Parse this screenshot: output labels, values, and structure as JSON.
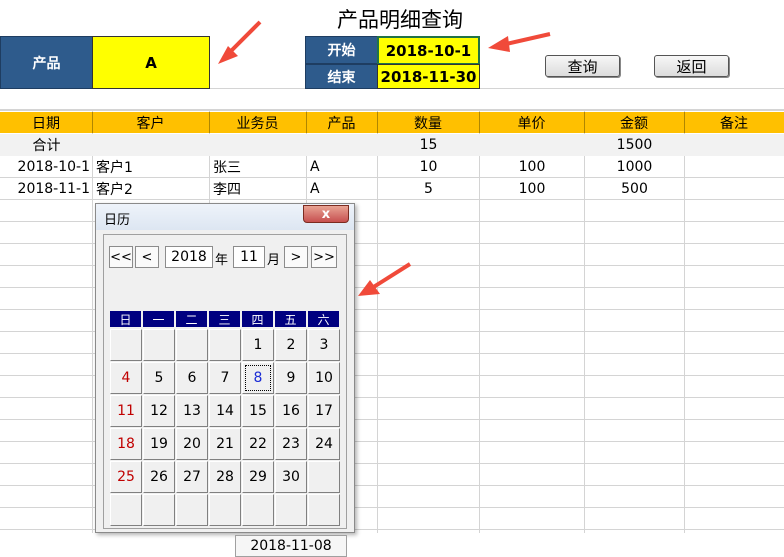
{
  "title": "产品明细查询",
  "filters": {
    "product_label": "产品",
    "product_value": "A",
    "start_label": "开始",
    "start_value": "2018-10-1",
    "end_label": "结束",
    "end_value": "2018-11-30"
  },
  "buttons": {
    "query": "查询",
    "back": "返回"
  },
  "table": {
    "headers": [
      "日期",
      "客户",
      "业务员",
      "产品",
      "数量",
      "单价",
      "金额",
      "备注"
    ],
    "total": {
      "label": "合计",
      "qty": "15",
      "amount": "1500"
    },
    "rows": [
      {
        "date": "2018-10-1",
        "customer": "客户1",
        "salesman": "张三",
        "product": "A",
        "qty": "10",
        "price": "100",
        "amount": "1000",
        "note": ""
      },
      {
        "date": "2018-11-1",
        "customer": "客户2",
        "salesman": "李四",
        "product": "A",
        "qty": "5",
        "price": "100",
        "amount": "500",
        "note": ""
      }
    ]
  },
  "calendar": {
    "title": "日历",
    "close": "x",
    "nav": {
      "first": "<<",
      "prev": "<",
      "next": ">",
      "last": ">>"
    },
    "year": "2018",
    "year_unit": "年",
    "month": "11",
    "month_unit": "月",
    "weekdays": [
      "日",
      "一",
      "二",
      "三",
      "四",
      "五",
      "六"
    ],
    "weeks": [
      [
        "",
        "",
        "",
        "",
        "1",
        "2",
        "3"
      ],
      [
        "4",
        "5",
        "6",
        "7",
        "8",
        "9",
        "10"
      ],
      [
        "11",
        "12",
        "13",
        "14",
        "15",
        "16",
        "17"
      ],
      [
        "18",
        "19",
        "20",
        "21",
        "22",
        "23",
        "24"
      ],
      [
        "25",
        "26",
        "27",
        "28",
        "29",
        "30",
        ""
      ],
      [
        "",
        "",
        "",
        "",
        "",
        "",
        ""
      ]
    ],
    "selected_day": "8",
    "today": "2018-11-08"
  },
  "colors": {
    "header_bg": "#ffc000",
    "label_bg": "#2e5b8c",
    "input_bg": "#ffff00",
    "arrow": "#f04a3a",
    "weekday_bg": "#000080"
  }
}
